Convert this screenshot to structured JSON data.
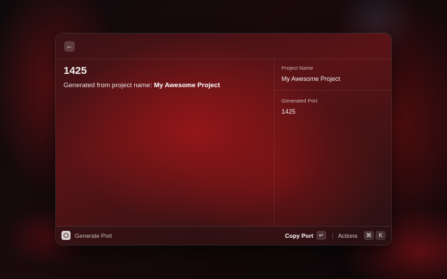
{
  "detail": {
    "port": "1425",
    "description_prefix": "Generated from project name: ",
    "description_project": "My Awesome Project"
  },
  "metadata": {
    "project_name_label": "Project Name",
    "project_name_value": "My Awesome Project",
    "generated_port_label": "Generated Port",
    "generated_port_value": "1425"
  },
  "bottom_bar": {
    "title": "Generate Port",
    "primary_action": "Copy Port",
    "primary_shortcut": "↵",
    "actions_label": "Actions",
    "actions_shortcut_mod": "⌘",
    "actions_shortcut_key": "K"
  },
  "icons": {
    "back": "arrow-left-icon",
    "extension": "extension-icon"
  }
}
